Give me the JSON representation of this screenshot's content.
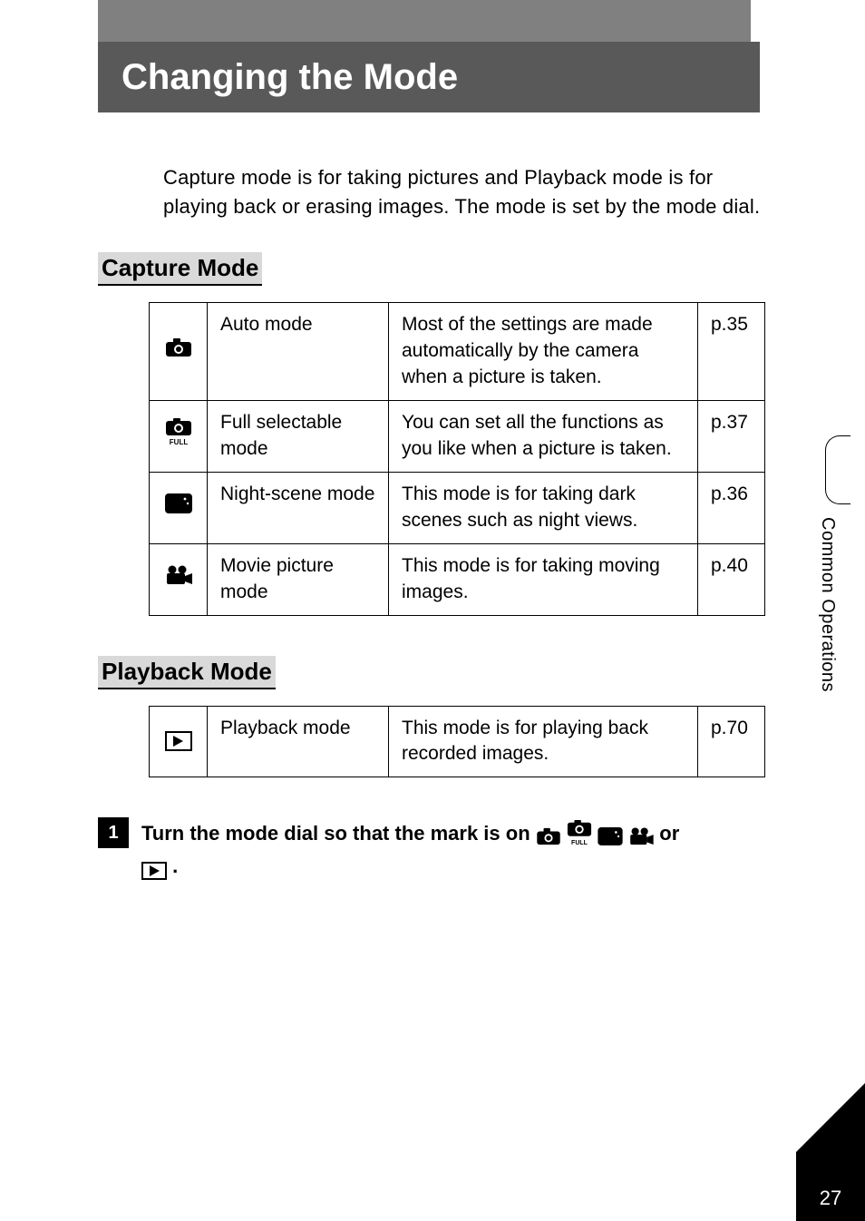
{
  "header": {
    "title": "Changing the Mode"
  },
  "intro": "Capture mode is for taking pictures and Playback mode is for playing back or erasing images. The mode is set by the mode dial.",
  "capture": {
    "heading": "Capture Mode",
    "rows": [
      {
        "name": "Auto mode",
        "desc": "Most of the settings are made automatically by the camera when a picture is taken.",
        "page": "p.35"
      },
      {
        "name": "Full selectable mode",
        "desc": "You can set all the functions as you like when a picture is taken.",
        "page": "p.37"
      },
      {
        "name": "Night-scene mode",
        "desc": "This mode is for taking dark scenes such as night views.",
        "page": "p.36"
      },
      {
        "name": "Movie picture mode",
        "desc": "This mode is for taking moving images.",
        "page": "p.40"
      }
    ]
  },
  "playback": {
    "heading": "Playback Mode",
    "rows": [
      {
        "name": "Playback mode",
        "desc": "This mode is for playing back recorded images.",
        "page": "p.70"
      }
    ]
  },
  "step": {
    "num": "1",
    "text_before": "Turn the mode dial so that the mark is on ",
    "text_after_icons": " or",
    "text_line2_after": " ."
  },
  "side": {
    "label": "Common Operations"
  },
  "page_number": "27"
}
